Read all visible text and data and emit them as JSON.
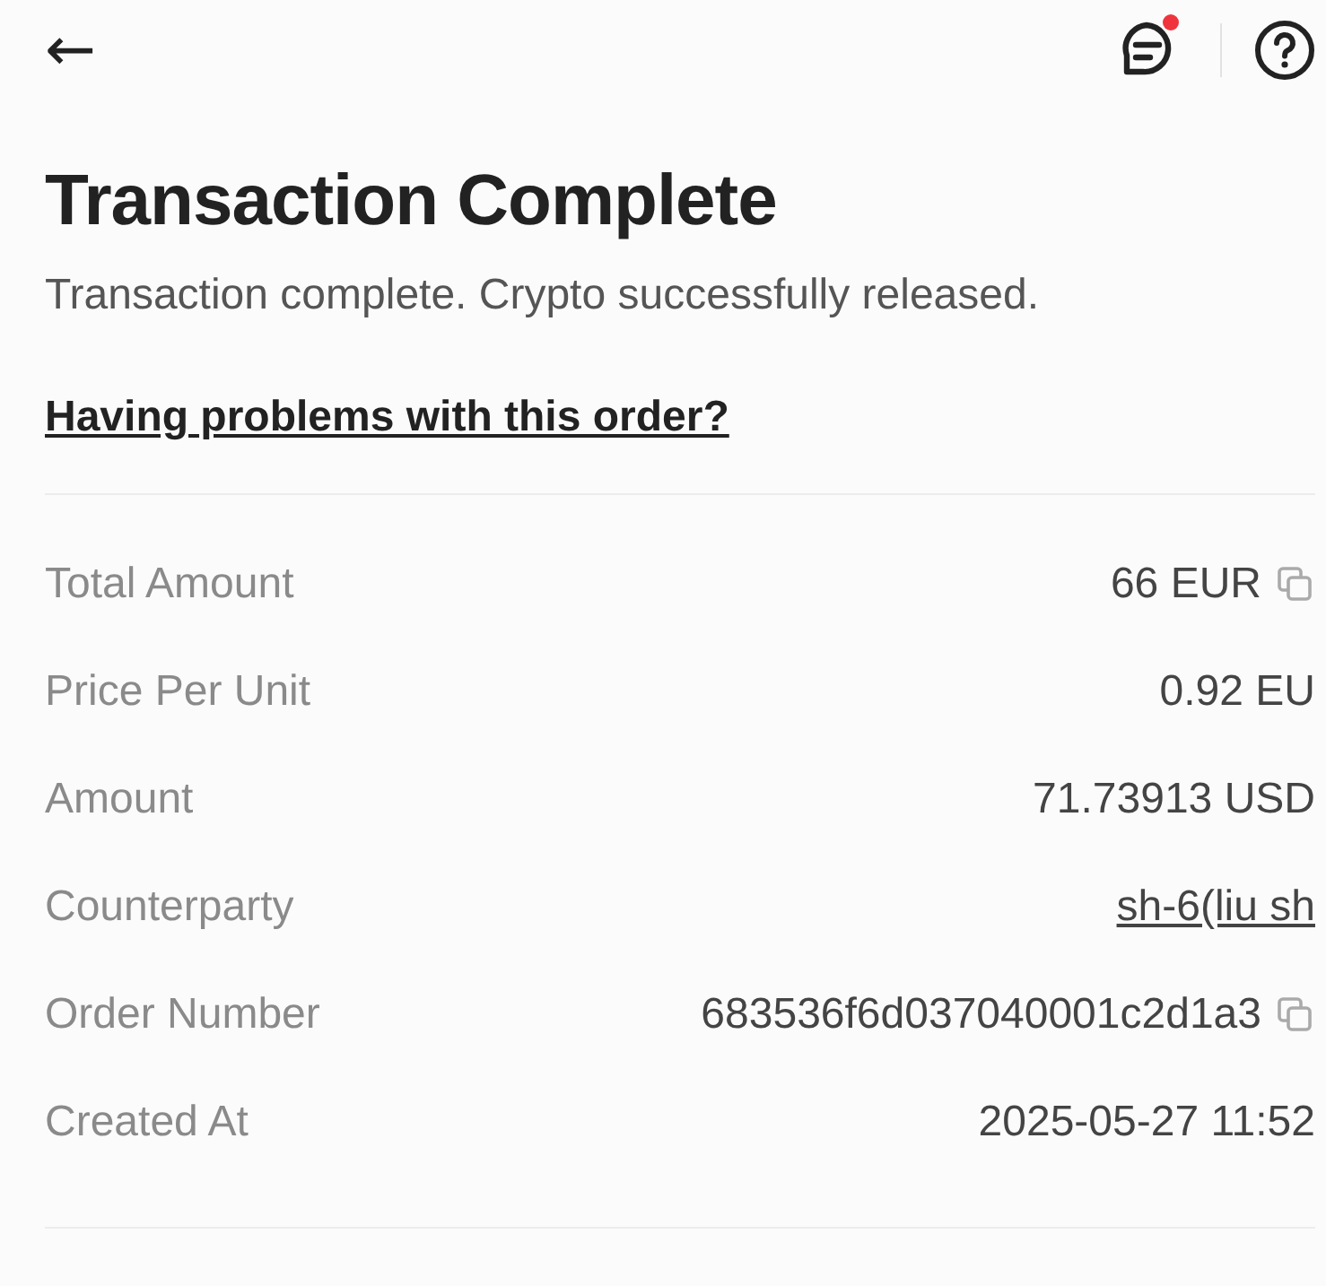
{
  "header": {
    "back": "←",
    "has_notification": true
  },
  "title": "Transaction Complete",
  "subtitle": "Transaction complete. Crypto successfully released.",
  "help_link": "Having problems with this order?",
  "details": [
    {
      "label": "Total Amount",
      "value": "66 EUR",
      "kind": "copy"
    },
    {
      "label": "Price Per Unit",
      "value": "0.92 EU",
      "kind": "plain"
    },
    {
      "label": "Amount",
      "value": "71.73913 USD",
      "kind": "plain"
    },
    {
      "label": "Counterparty",
      "value": "sh-6(liu sh",
      "kind": "link"
    },
    {
      "label": "Order Number",
      "value": "683536f6d037040001c2d1a3",
      "kind": "copy"
    },
    {
      "label": "Created At",
      "value": "2025-05-27 11:52",
      "kind": "plain"
    }
  ]
}
